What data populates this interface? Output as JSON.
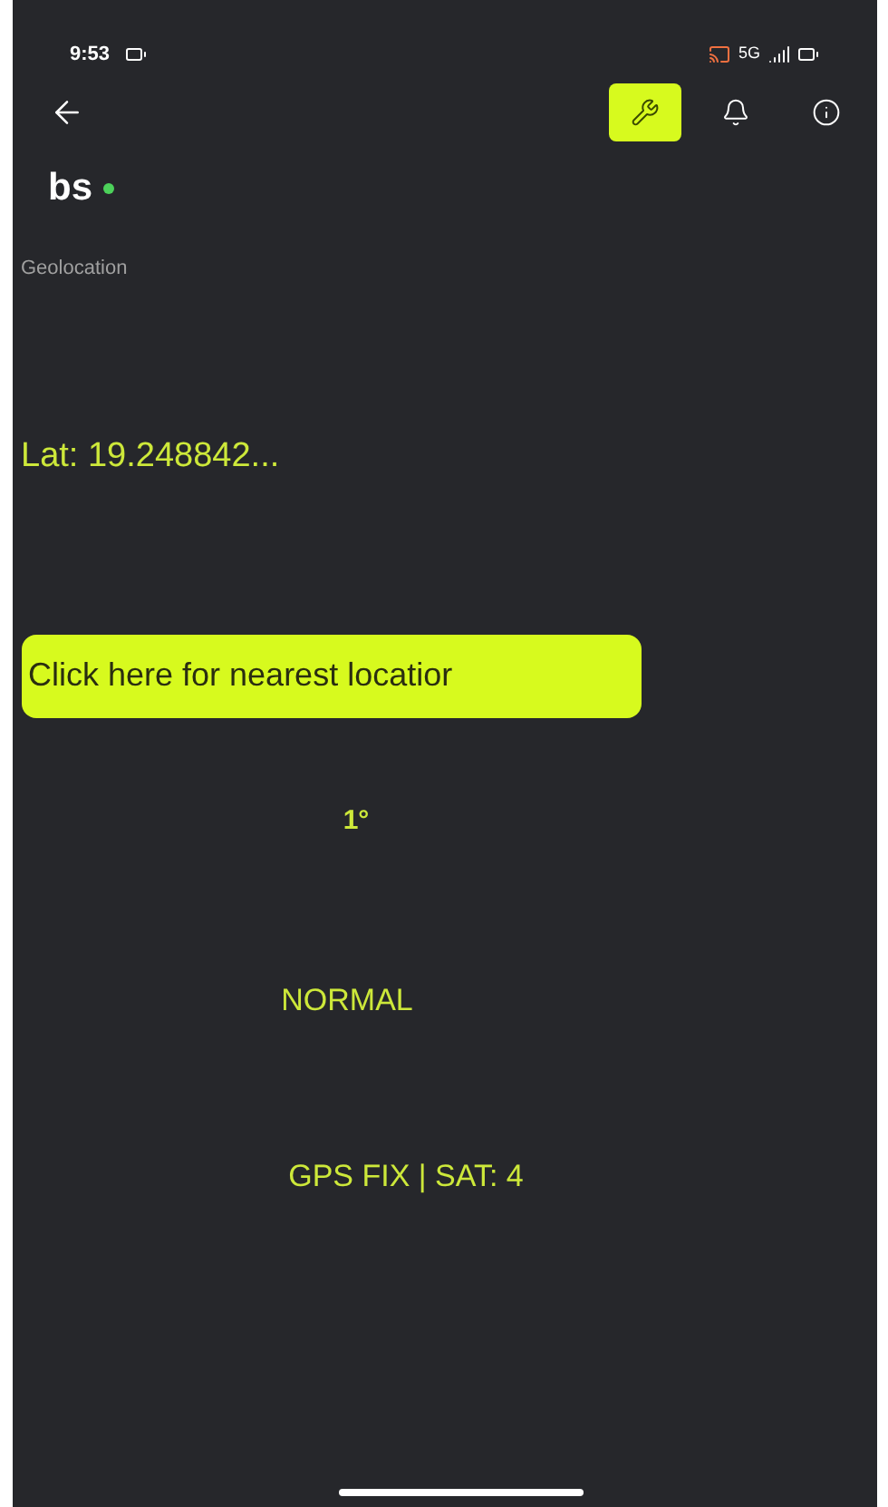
{
  "status_bar": {
    "time": "9:53",
    "network": "5G"
  },
  "toolbar": {
    "actions": [
      {
        "kind": "wrench",
        "selected": true
      },
      {
        "kind": "bell",
        "selected": false
      },
      {
        "kind": "info",
        "selected": false
      }
    ]
  },
  "device": {
    "name": "bs",
    "online": true
  },
  "section_label": "Geolocation",
  "latitude": "Lat: 19.248842...",
  "nearest_button": "Click here for nearest locatior",
  "heading": "1°",
  "mode": "NORMAL",
  "gps_status": "GPS FIX | SAT: 4"
}
